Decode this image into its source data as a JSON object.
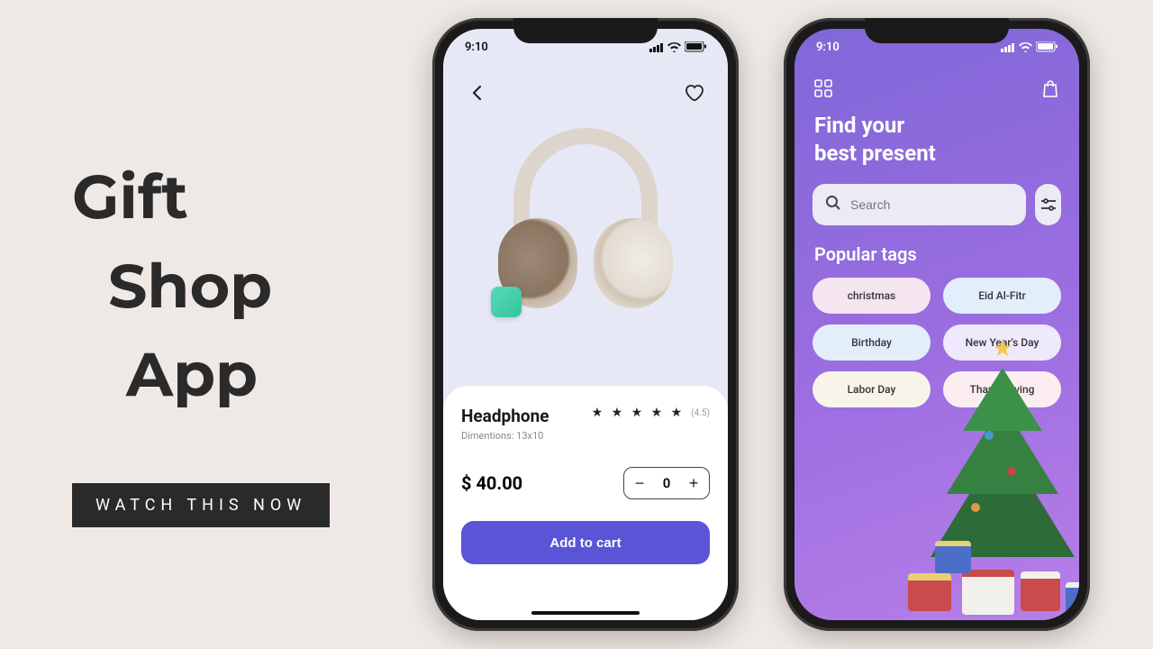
{
  "headline": {
    "line1": "Gift",
    "line2": "Shop",
    "line3": "App"
  },
  "cta": "WATCH THIS NOW",
  "statusbar": {
    "time": "9:10"
  },
  "product": {
    "name": "Headphone",
    "dimensions": "Dimentions: 13x10",
    "stars": "★ ★ ★ ★ ★",
    "rating_count": "(4.5)",
    "price": "$ 40.00",
    "quantity": "0",
    "add_label": "Add to cart"
  },
  "search": {
    "heading_line1": "Find your",
    "heading_line2": "best present",
    "placeholder": "Search",
    "popular_title": "Popular tags",
    "tags": {
      "t0": "christmas",
      "t1": "Eid Al-Fitr",
      "t2": "Birthday",
      "t3": "New Year's Day",
      "t4": "Labor Day",
      "t5": "Thanksgiving"
    }
  }
}
